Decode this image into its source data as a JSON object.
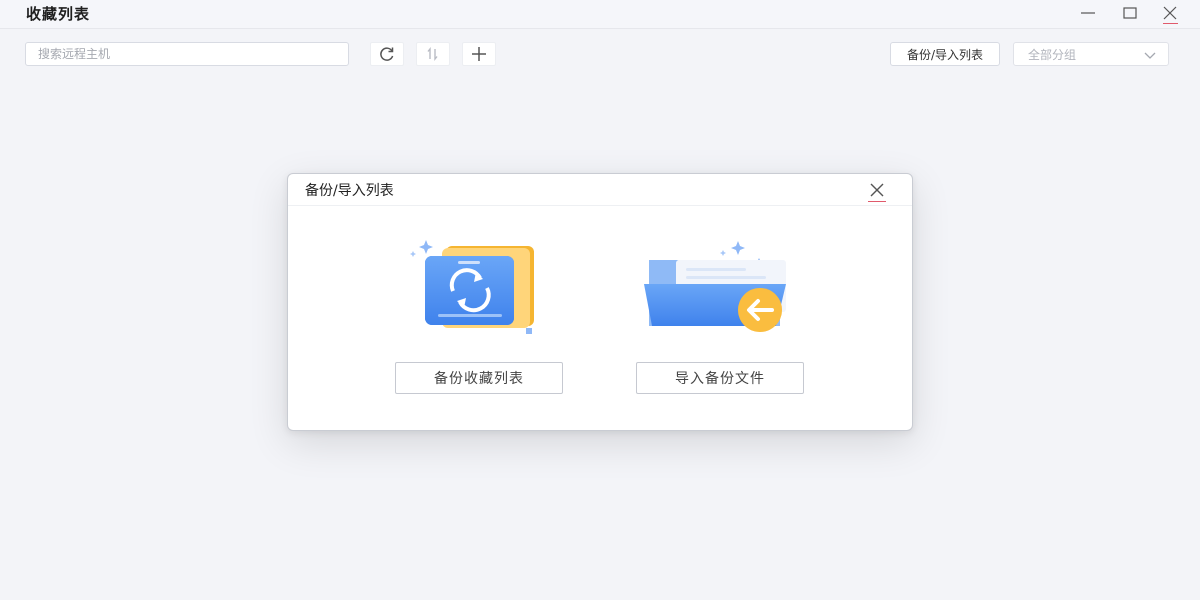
{
  "window": {
    "title": "收藏列表",
    "controls": {
      "minimize_icon": "minimize-icon",
      "maximize_icon": "maximize-icon",
      "close_icon": "close-icon"
    }
  },
  "toolbar": {
    "search_placeholder": "搜索远程主机",
    "search_value": "",
    "refresh_icon": "refresh-icon",
    "sort_icon": "sort-icon",
    "add_icon": "plus-icon",
    "backup_import_label": "备份/导入列表",
    "group_select_value": "全部分组"
  },
  "dialog": {
    "title": "备份/导入列表",
    "close_icon": "close-icon",
    "options": [
      {
        "illustration": "backup-sync-illustration",
        "label": "备份收藏列表"
      },
      {
        "illustration": "import-folder-illustration",
        "label": "导入备份文件"
      }
    ]
  },
  "colors": {
    "background": "#f3f4f8",
    "accent_blue": "#4a8ff0",
    "accent_orange": "#f5b531",
    "close_underline": "#e05a6c"
  }
}
